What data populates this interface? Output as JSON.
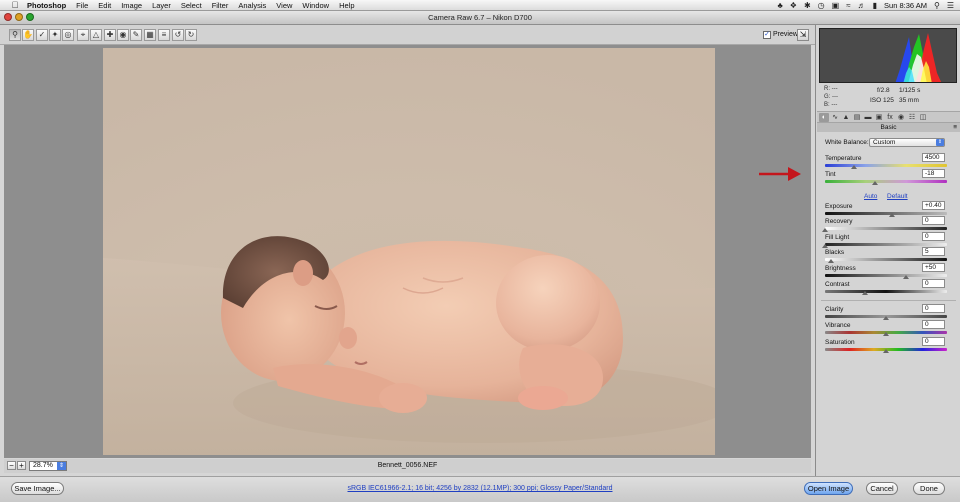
{
  "menubar": {
    "app_name": "Photoshop",
    "items": [
      "File",
      "Edit",
      "Image",
      "Layer",
      "Select",
      "Filter",
      "Analysis",
      "View",
      "Window",
      "Help"
    ],
    "clock": "Sun 8:36 AM"
  },
  "window": {
    "title": "Camera Raw 6.7  –  Nikon D700"
  },
  "toolbar": {
    "tools": [
      "zoom-tool",
      "hand-tool",
      "white-balance-tool",
      "color-sampler-tool",
      "targeted-adjustment-tool",
      "crop-tool",
      "straighten-tool",
      "spot-removal-tool",
      "red-eye-tool",
      "adjustment-brush-tool",
      "graduated-filter-tool",
      "open-preferences",
      "rotate-ccw",
      "rotate-cw"
    ],
    "preview_label": "Preview",
    "preview_checked": true
  },
  "canvas": {
    "zoom_value": "28.7%",
    "filename": "Bennett_0056.NEF"
  },
  "bottombar": {
    "save_label": "Save Image...",
    "workflow_text": "sRGB IEC61966-2.1; 16 bit; 4256 by 2832 (12.1MP); 300 ppi; Glossy Paper/Standard",
    "open_label": "Open Image",
    "cancel_label": "Cancel",
    "done_label": "Done"
  },
  "info": {
    "r": "R:  ---",
    "g": "G:  ---",
    "b": "B:  ---",
    "aperture": "f/2.8",
    "shutter": "1/125 s",
    "iso": "ISO 125",
    "focal": "35 mm"
  },
  "panel": {
    "section_title": "Basic",
    "white_balance_label": "White Balance:",
    "white_balance_value": "Custom",
    "auto_label": "Auto",
    "default_label": "Default",
    "sliders": {
      "temperature": {
        "label": "Temperature",
        "value": "4500",
        "position": 0.24
      },
      "tint": {
        "label": "Tint",
        "value": "-18",
        "position": 0.41
      },
      "exposure": {
        "label": "Exposure",
        "value": "+0.40",
        "position": 0.55
      },
      "recovery": {
        "label": "Recovery",
        "value": "0",
        "position": 0.0
      },
      "fill_light": {
        "label": "Fill Light",
        "value": "0",
        "position": 0.0
      },
      "blacks": {
        "label": "Blacks",
        "value": "5",
        "position": 0.05
      },
      "brightness": {
        "label": "Brightness",
        "value": "+50",
        "position": 0.66
      },
      "contrast": {
        "label": "Contrast",
        "value": "0",
        "position": 0.33
      },
      "clarity": {
        "label": "Clarity",
        "value": "0",
        "position": 0.5
      },
      "vibrance": {
        "label": "Vibrance",
        "value": "0",
        "position": 0.5
      },
      "saturation": {
        "label": "Saturation",
        "value": "0",
        "position": 0.5
      }
    }
  },
  "colors": {
    "annotation_arrow": "#c4161c",
    "accent": "#4a7de0"
  }
}
